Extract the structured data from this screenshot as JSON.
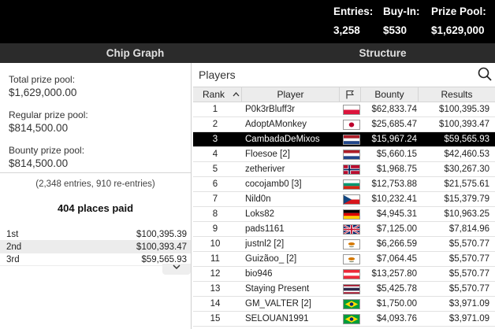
{
  "header": {
    "entries_label": "Entries:",
    "entries_value": "3,258",
    "buyin_label": "Buy-In:",
    "buyin_value": "$530",
    "prize_label": "Prize Pool:",
    "prize_value": "$1,629,000"
  },
  "tabs": [
    {
      "label": "Chip Graph"
    },
    {
      "label": "Structure"
    }
  ],
  "left_panel": {
    "total_label": "Total prize pool:",
    "total_value": "$1,629,000.00",
    "regular_label": "Regular prize pool:",
    "regular_value": "$814,500.00",
    "bounty_label": "Bounty prize pool:",
    "bounty_value": "$814,500.00",
    "entries_line": "(2,348 entries, 910 re-entries)",
    "places_paid": "404 places paid",
    "payouts": [
      {
        "place": "1st",
        "amount": "$100,395.39"
      },
      {
        "place": "2nd",
        "amount": "$100,393.47"
      },
      {
        "place": "3rd",
        "amount": "$59,565.93"
      }
    ],
    "expand_icon": "chevron-down-icon"
  },
  "players_panel": {
    "title": "Players",
    "search_icon": "search-icon",
    "columns": {
      "rank": "Rank",
      "sort_icon": "^",
      "player": "Player",
      "flag_icon": "flag-icon",
      "bounty": "Bounty",
      "results": "Results"
    },
    "selected_rank": "3",
    "rows": [
      {
        "rank": "1",
        "player": "P0k3rBluff3r",
        "flag": "poland",
        "bounty": "$62,833.74",
        "results": "$100,395.39"
      },
      {
        "rank": "2",
        "player": "AdoptAMonkey",
        "flag": "japan",
        "bounty": "$25,685.47",
        "results": "$100,393.47"
      },
      {
        "rank": "3",
        "player": "CambadaDeMixos",
        "flag": "netherlands",
        "bounty": "$15,967.24",
        "results": "$59,565.93"
      },
      {
        "rank": "4",
        "player": "Floesoe [2]",
        "flag": "netherlands",
        "bounty": "$5,660.15",
        "results": "$42,460.53"
      },
      {
        "rank": "5",
        "player": "zetheriver",
        "flag": "norway",
        "bounty": "$1,968.75",
        "results": "$30,267.30"
      },
      {
        "rank": "6",
        "player": "cocojamb0 [3]",
        "flag": "bulgaria",
        "bounty": "$12,753.88",
        "results": "$21,575.61"
      },
      {
        "rank": "7",
        "player": "Nild0n",
        "flag": "czech",
        "bounty": "$10,232.41",
        "results": "$15,379.79"
      },
      {
        "rank": "8",
        "player": "Loks82",
        "flag": "germany",
        "bounty": "$4,945.31",
        "results": "$10,963.25"
      },
      {
        "rank": "9",
        "player": "pads1161",
        "flag": "uk",
        "bounty": "$7,125.00",
        "results": "$7,814.96"
      },
      {
        "rank": "10",
        "player": "justnl2 [2]",
        "flag": "cyprus",
        "bounty": "$6,266.59",
        "results": "$5,570.77"
      },
      {
        "rank": "11",
        "player": "Guizãoo_ [2]",
        "flag": "cyprus",
        "bounty": "$7,064.45",
        "results": "$5,570.77"
      },
      {
        "rank": "12",
        "player": "bio946",
        "flag": "austria",
        "bounty": "$13,257.80",
        "results": "$5,570.77"
      },
      {
        "rank": "13",
        "player": "Staying Present",
        "flag": "thailand",
        "bounty": "$5,425.78",
        "results": "$5,570.77"
      },
      {
        "rank": "14",
        "player": "GM_VALTER [2]",
        "flag": "brazil",
        "bounty": "$1,750.00",
        "results": "$3,971.09"
      },
      {
        "rank": "15",
        "player": "SELOUAN1991",
        "flag": "brazil",
        "bounty": "$4,093.76",
        "results": "$3,971.09"
      }
    ]
  }
}
